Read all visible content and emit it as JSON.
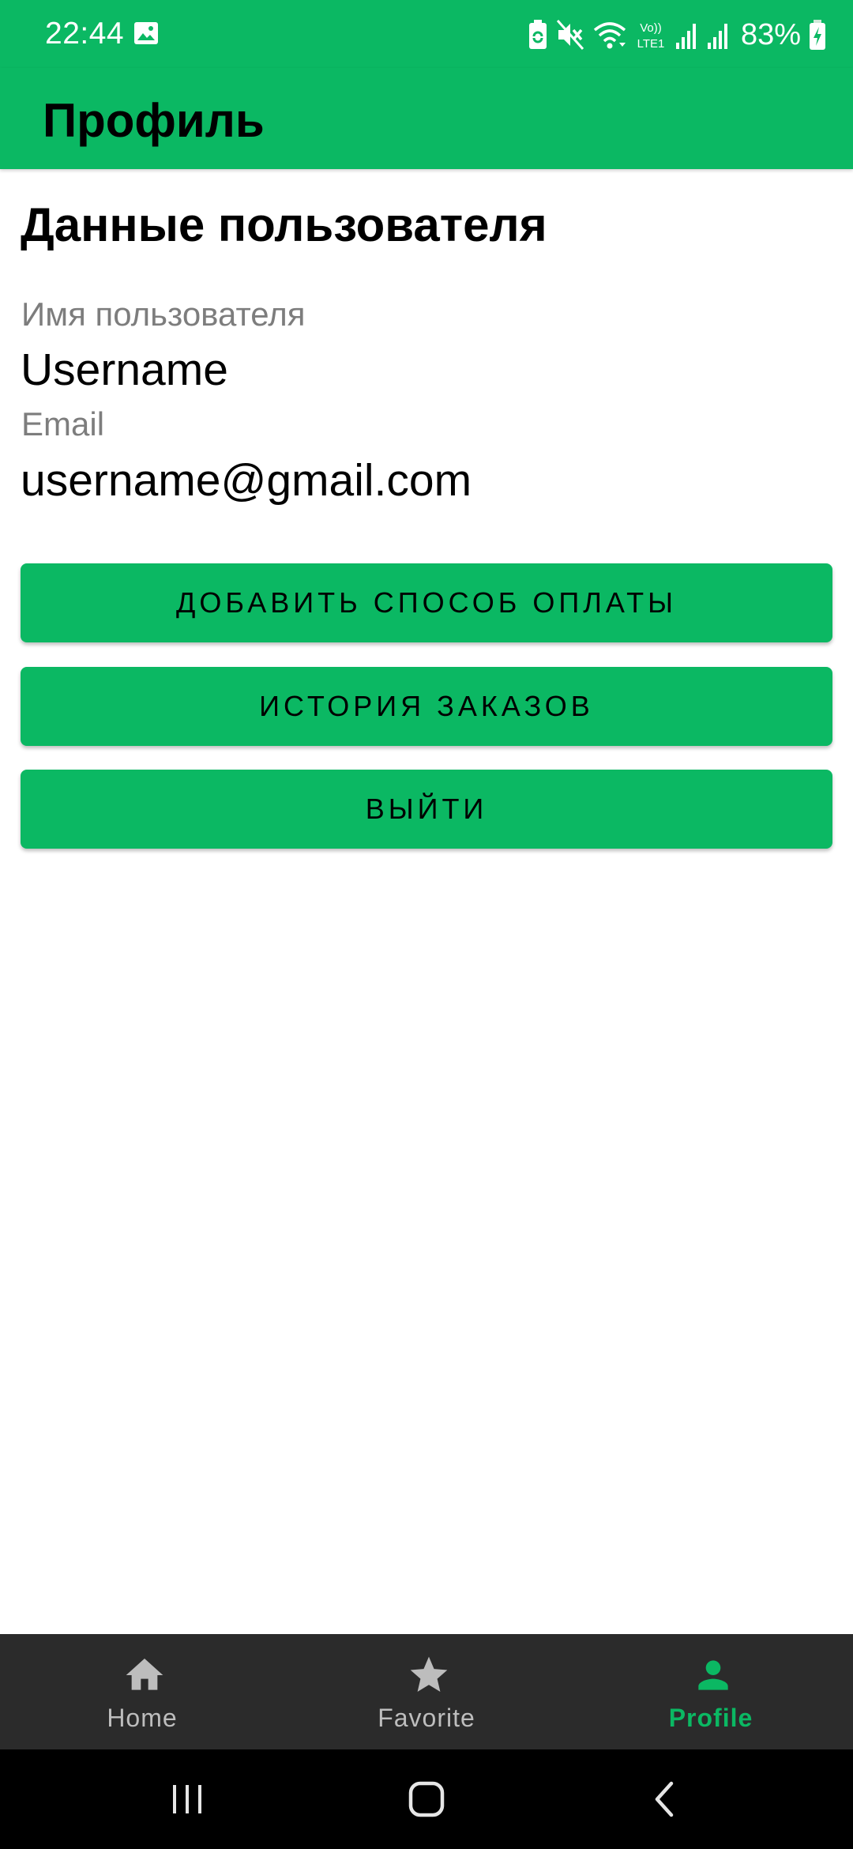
{
  "status_bar": {
    "time": "22:44",
    "battery_percent": "83%",
    "icons": [
      "gallery-icon",
      "battery-saver-icon",
      "mute-icon",
      "wifi-icon",
      "volte-icon",
      "signal-icon",
      "signal-icon",
      "battery-charging-icon"
    ],
    "volte_top": "Vo))",
    "volte_bottom": "LTE1"
  },
  "app_bar": {
    "title": "Профиль"
  },
  "profile": {
    "section_title": "Данные пользователя",
    "username_label": "Имя пользователя",
    "username_value": "Username",
    "email_label": "Email",
    "email_value": "username@gmail.com"
  },
  "actions": {
    "add_payment": "ДОБАВИТЬ СПОСОБ ОПЛАТЫ",
    "order_history": "ИСТОРИЯ ЗАКАЗОВ",
    "logout": "ВЫЙТИ"
  },
  "bottom_nav": {
    "items": [
      {
        "label": "Home",
        "icon": "home-icon",
        "active": false
      },
      {
        "label": "Favorite",
        "icon": "star-icon",
        "active": false
      },
      {
        "label": "Profile",
        "icon": "person-icon",
        "active": true
      }
    ]
  },
  "colors": {
    "accent": "#0bb863",
    "nav_background": "#2b2b2b",
    "inactive_nav": "#bdbdbd",
    "label_gray": "#7d7d7d"
  }
}
